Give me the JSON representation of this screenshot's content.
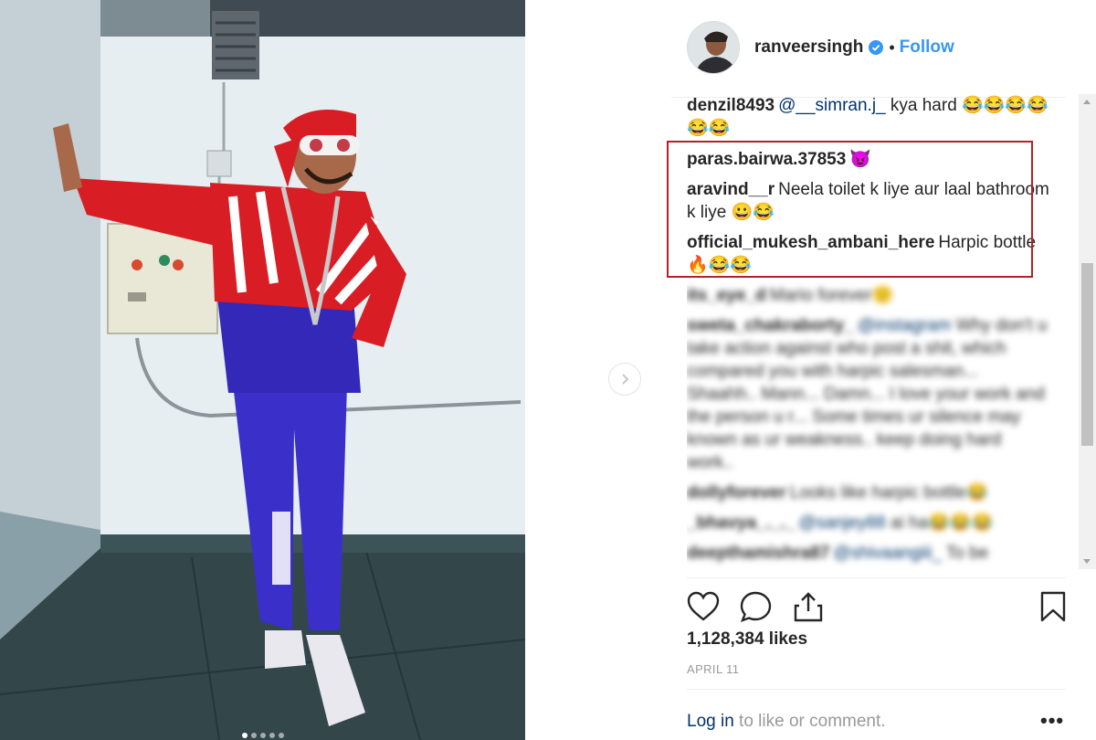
{
  "post": {
    "username": "ranveersingh",
    "follow_label": "Follow",
    "separator": "•",
    "likes": "1,128,384 likes",
    "date": "APRIL 11",
    "carousel_count": 5,
    "carousel_active": 1
  },
  "comments": [
    {
      "user": "denzil8493",
      "mention": "@__simran.j_",
      "text": " kya hard 😂😂😂😂😂😂"
    },
    {
      "user": "paras.bairwa.37853",
      "mention": "",
      "text": "😈"
    },
    {
      "user": "aravind__r",
      "mention": "",
      "text": "Neela toilet k liye aur laal bathroom k liye 😀😂"
    },
    {
      "user": "official_mukesh_ambani_here",
      "mention": "",
      "text": "Harpic bottle 🔥😂😂"
    },
    {
      "user": "its_eye_d",
      "mention": "",
      "text": "Mario forever🙂"
    },
    {
      "user": "sweta_chakraborty_",
      "mention": "@instagram",
      "text": " Why don't u take action against who post a shit, which compared you with harpic salesman... Shaahh.. Mann... Damn... I love your work and the person u r... Some times ur silence may known as ur weakness.. keep doing hard work.."
    },
    {
      "user": "dollyforever",
      "mention": "",
      "text": "Looks like harpic bottle😂"
    },
    {
      "user": "_bhavya_._._",
      "mention": "@sanjey88",
      "text": " ai ha😂😂😂"
    },
    {
      "user": "deepthamishra87",
      "mention": "@shivaangiii_",
      "text": " To be"
    }
  ],
  "footer": {
    "login_link": "Log in",
    "login_rest": " to like or comment.",
    "more_label": "•••"
  },
  "colors": {
    "link_blue": "#3897f0",
    "highlight_red": "#b5202a",
    "mention_navy": "#003569"
  },
  "icons": [
    "heart-icon",
    "comment-icon",
    "share-icon",
    "bookmark-icon",
    "verified-badge-icon",
    "chevron-right-icon"
  ]
}
